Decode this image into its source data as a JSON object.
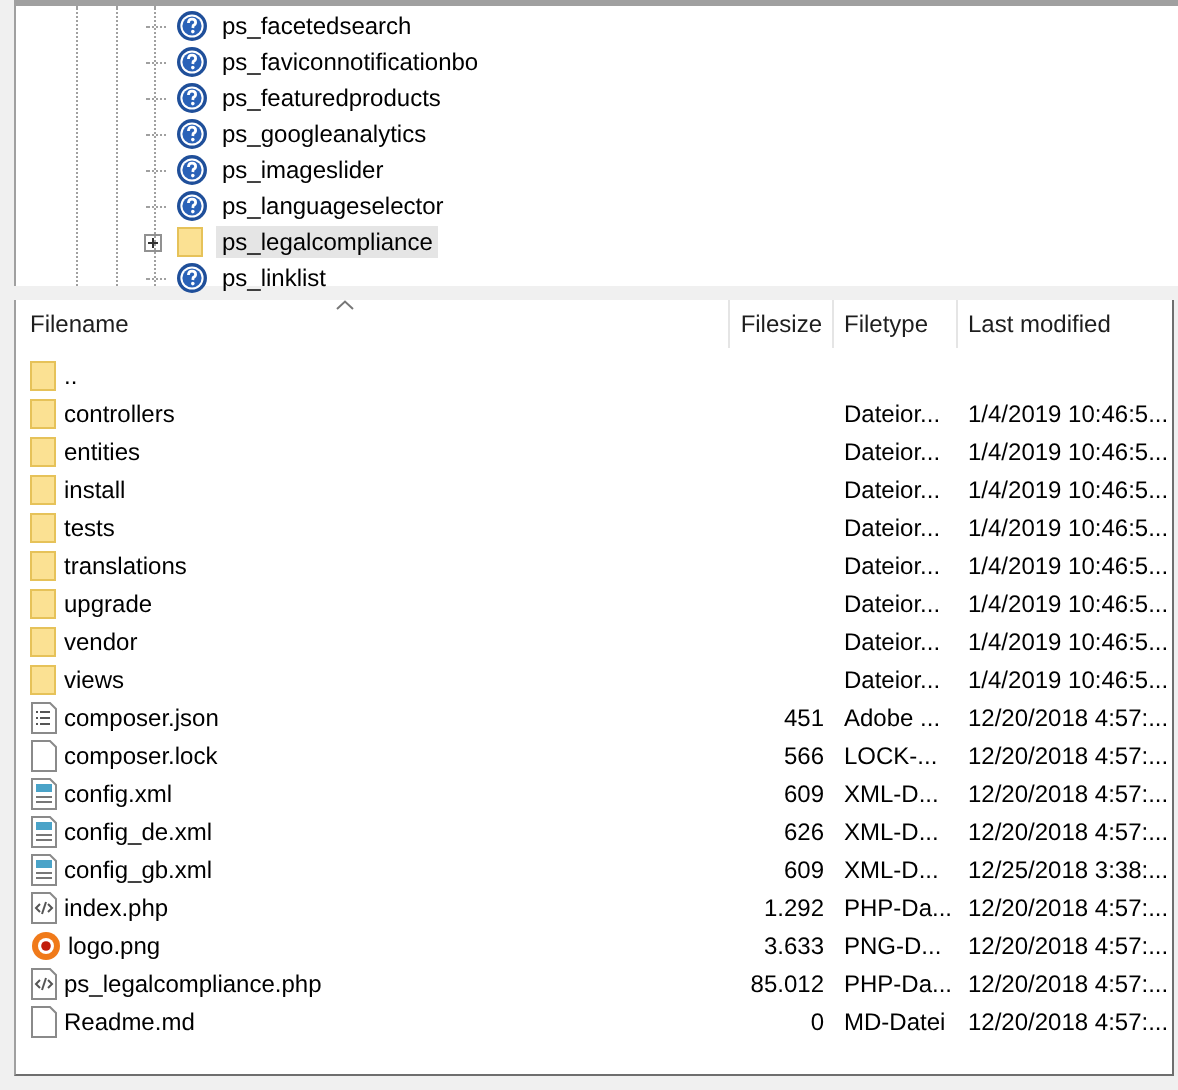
{
  "tree": {
    "items": [
      {
        "label": "ps_facetedsearch",
        "kind": "unknown",
        "selected": false
      },
      {
        "label": "ps_faviconnotificationbo",
        "kind": "unknown",
        "selected": false
      },
      {
        "label": "ps_featuredproducts",
        "kind": "unknown",
        "selected": false
      },
      {
        "label": "ps_googleanalytics",
        "kind": "unknown",
        "selected": false
      },
      {
        "label": "ps_imageslider",
        "kind": "unknown",
        "selected": false
      },
      {
        "label": "ps_languageselector",
        "kind": "unknown",
        "selected": false
      },
      {
        "label": "ps_legalcompliance",
        "kind": "folder",
        "selected": true,
        "expanded": false
      },
      {
        "label": "ps_linklist",
        "kind": "unknown",
        "selected": false
      }
    ]
  },
  "file_list": {
    "columns": [
      {
        "label": "Filename",
        "sorted": true
      },
      {
        "label": "Filesize",
        "sorted": false
      },
      {
        "label": "Filetype",
        "sorted": false
      },
      {
        "label": "Last modified",
        "sorted": false
      }
    ],
    "rows": [
      {
        "kind": "folder",
        "name": ".."
      },
      {
        "kind": "folder",
        "name": "controllers",
        "type": "Dateior...",
        "modified": "1/4/2019 10:46:5..."
      },
      {
        "kind": "folder",
        "name": "entities",
        "type": "Dateior...",
        "modified": "1/4/2019 10:46:5..."
      },
      {
        "kind": "folder",
        "name": "install",
        "type": "Dateior...",
        "modified": "1/4/2019 10:46:5..."
      },
      {
        "kind": "folder",
        "name": "tests",
        "type": "Dateior...",
        "modified": "1/4/2019 10:46:5..."
      },
      {
        "kind": "folder",
        "name": "translations",
        "type": "Dateior...",
        "modified": "1/4/2019 10:46:5..."
      },
      {
        "kind": "folder",
        "name": "upgrade",
        "type": "Dateior...",
        "modified": "1/4/2019 10:46:5..."
      },
      {
        "kind": "folder",
        "name": "vendor",
        "type": "Dateior...",
        "modified": "1/4/2019 10:46:5..."
      },
      {
        "kind": "folder",
        "name": "views",
        "type": "Dateior...",
        "modified": "1/4/2019 10:46:5..."
      },
      {
        "kind": "list",
        "name": "composer.json",
        "size": "451",
        "type": "Adobe ...",
        "modified": "12/20/2018 4:57:..."
      },
      {
        "kind": "blank",
        "name": "composer.lock",
        "size": "566",
        "type": "LOCK-...",
        "modified": "12/20/2018 4:57:..."
      },
      {
        "kind": "xml",
        "name": "config.xml",
        "size": "609",
        "type": "XML-D...",
        "modified": "12/20/2018 4:57:..."
      },
      {
        "kind": "xml",
        "name": "config_de.xml",
        "size": "626",
        "type": "XML-D...",
        "modified": "12/20/2018 4:57:..."
      },
      {
        "kind": "xml",
        "name": "config_gb.xml",
        "size": "609",
        "type": "XML-D...",
        "modified": "12/25/2018 3:38:..."
      },
      {
        "kind": "code",
        "name": "index.php",
        "size": "1.292",
        "type": "PHP-Da...",
        "modified": "12/20/2018 4:57:..."
      },
      {
        "kind": "image",
        "name": "logo.png",
        "size": "3.633",
        "type": "PNG-D...",
        "modified": "12/20/2018 4:57:..."
      },
      {
        "kind": "code",
        "name": "ps_legalcompliance.php",
        "size": "85.012",
        "type": "PHP-Da...",
        "modified": "12/20/2018 4:57:..."
      },
      {
        "kind": "blank",
        "name": "Readme.md",
        "size": "0",
        "type": "MD-Datei",
        "modified": "12/20/2018 4:57:..."
      }
    ]
  }
}
